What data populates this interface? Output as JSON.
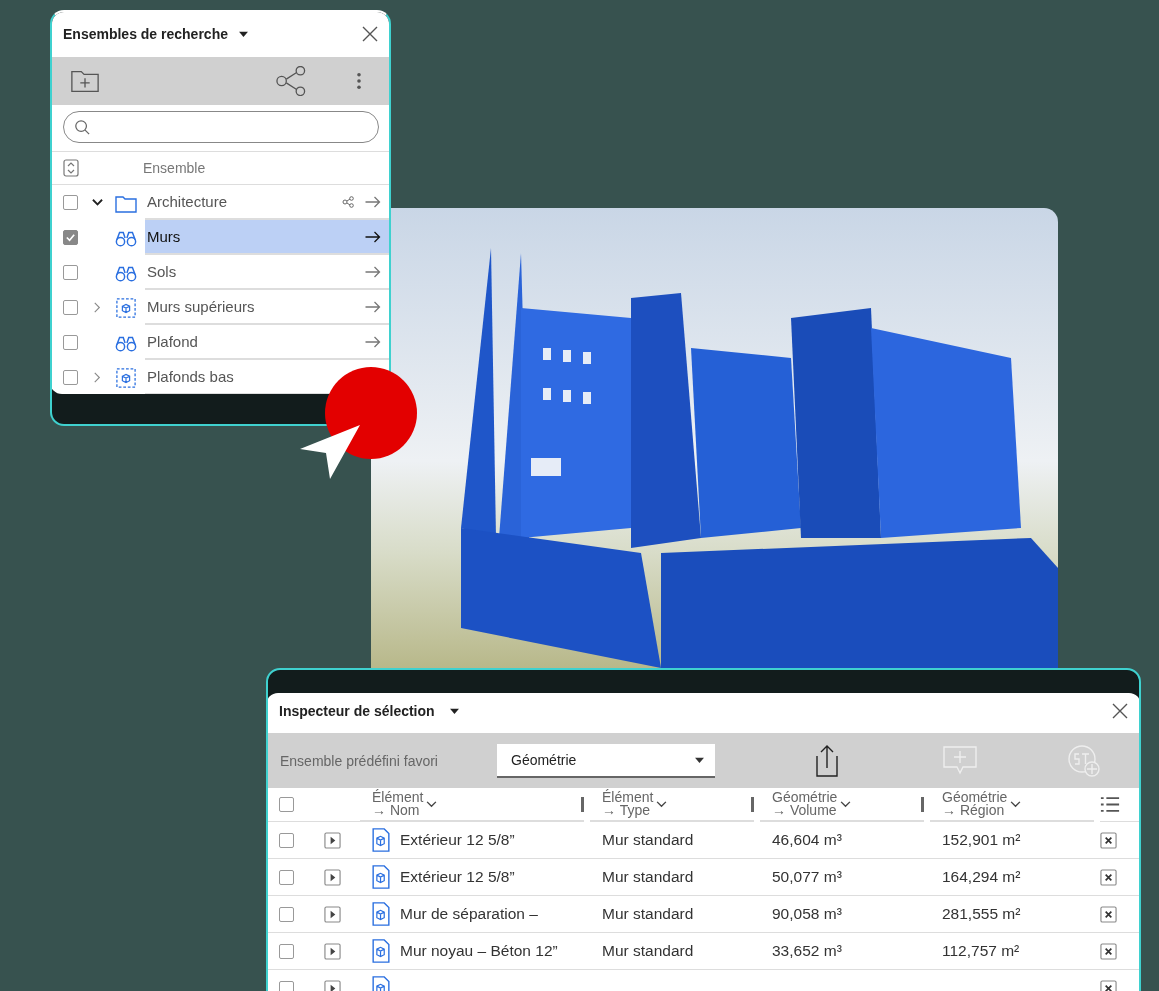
{
  "search_sets": {
    "title": "Ensembles de recherche",
    "column": "Ensemble",
    "items": [
      {
        "kind": "folder",
        "label": "Architecture",
        "expanded": true,
        "checked": false,
        "selected": false,
        "shared": true,
        "children": [
          {
            "kind": "search",
            "label": "Murs",
            "checked": true,
            "selected": true,
            "shared": false
          },
          {
            "kind": "search",
            "label": "Sols",
            "checked": false,
            "selected": false,
            "shared": false
          },
          {
            "kind": "selection",
            "label": "Murs supérieurs",
            "expanded": false,
            "checked": false,
            "selected": false,
            "shared": false
          },
          {
            "kind": "search",
            "label": "Plafond",
            "checked": false,
            "selected": false,
            "shared": false
          },
          {
            "kind": "selection",
            "label": "Plafonds bas",
            "expanded": false,
            "checked": false,
            "selected": false,
            "shared": false
          }
        ]
      }
    ]
  },
  "inspector": {
    "title": "Inspecteur de sélection",
    "favorite_label": "Ensemble prédéfini favori",
    "favorite_value": "Géométrie",
    "columns": [
      {
        "group": "Élément",
        "name": "→ Nom"
      },
      {
        "group": "Élément",
        "name": "→ Type"
      },
      {
        "group": "Géométrie",
        "name": "→ Volume"
      },
      {
        "group": "Géométrie",
        "name": "→ Région"
      }
    ],
    "all_checked": false,
    "rows": [
      {
        "checked": false,
        "name": "Extérieur 12 5/8”",
        "type": "Mur standard",
        "volume": "46,604 m³",
        "region": "152,901 m²"
      },
      {
        "checked": false,
        "name": "Extérieur 12 5/8”",
        "type": "Mur standard",
        "volume": "50,077 m³",
        "region": "164,294 m²"
      },
      {
        "checked": false,
        "name": "Mur de séparation –",
        "type": "Mur standard",
        "volume": "90,058 m³",
        "region": "281,555 m²"
      },
      {
        "checked": false,
        "name": "Mur noyau – Béton 12”",
        "type": "Mur standard",
        "volume": "33,652 m³",
        "region": "112,757 m²"
      },
      {
        "checked": false
      }
    ]
  }
}
